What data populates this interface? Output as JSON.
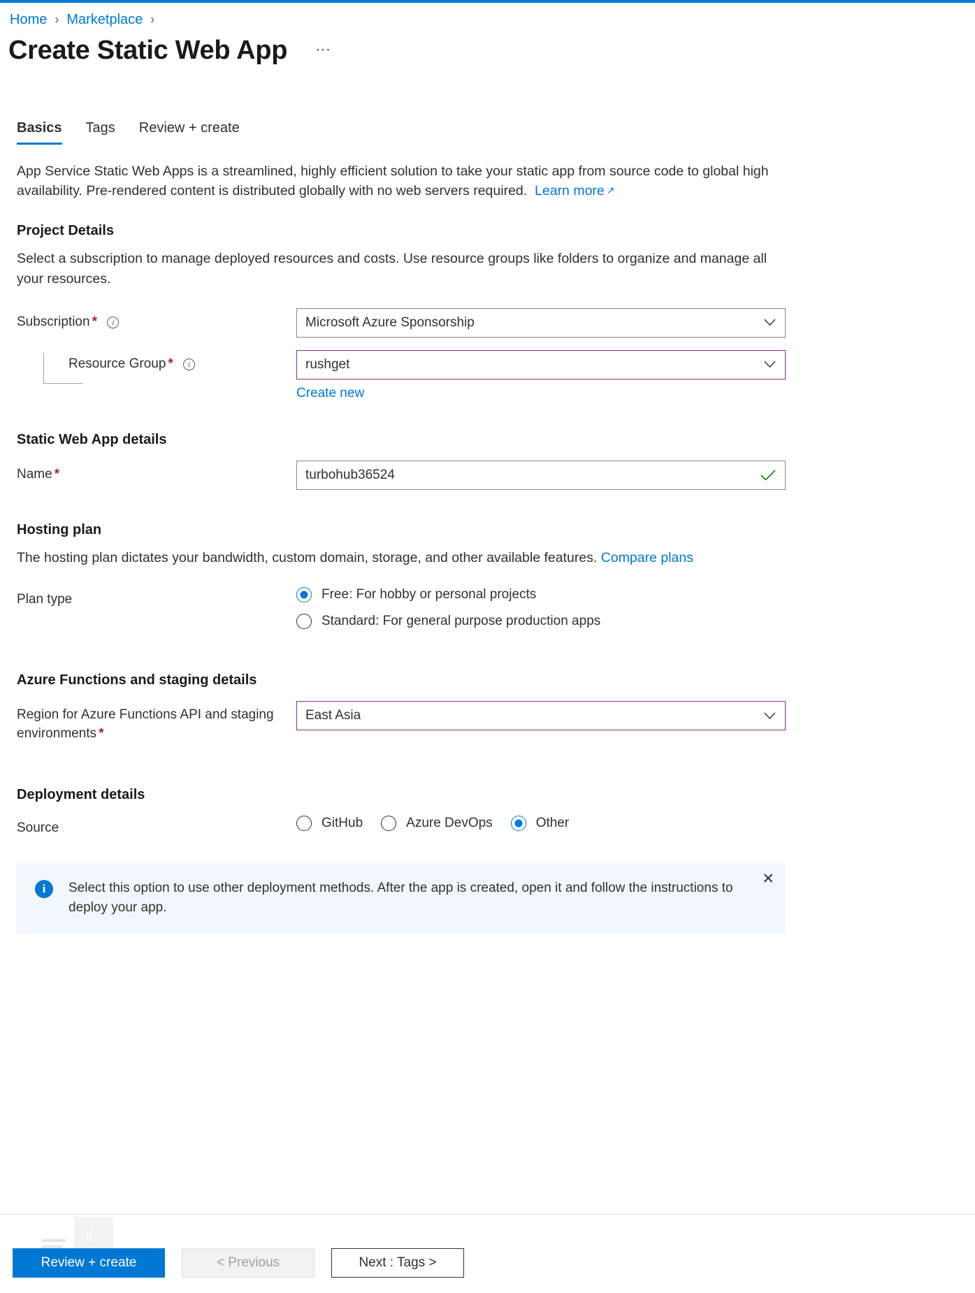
{
  "breadcrumb": {
    "items": [
      {
        "label": "Home"
      },
      {
        "label": "Marketplace"
      }
    ],
    "separator": "›"
  },
  "header": {
    "title": "Create Static Web App",
    "more_actions": "⋯"
  },
  "tabs": [
    {
      "label": "Basics",
      "active": true
    },
    {
      "label": "Tags",
      "active": false
    },
    {
      "label": "Review + create",
      "active": false
    }
  ],
  "intro": {
    "text": "App Service Static Web Apps is a streamlined, highly efficient solution to take your static app from source code to global high availability. Pre-rendered content is distributed globally with no web servers required.",
    "link_label": "Learn more",
    "link_icon": "external-link-icon"
  },
  "project_details": {
    "heading": "Project Details",
    "description": "Select a subscription to manage deployed resources and costs. Use resource groups like folders to organize and manage all your resources.",
    "subscription": {
      "label": "Subscription",
      "required": "*",
      "value": "Microsoft Azure Sponsorship"
    },
    "resource_group": {
      "label": "Resource Group",
      "required": "*",
      "value": "rushget",
      "create_new_label": "Create new",
      "highlight_color": "#8f2d8f"
    }
  },
  "static_web_app_details": {
    "heading": "Static Web App details",
    "name": {
      "label": "Name",
      "required": "*",
      "value": "turbohub36524",
      "validation_icon": "check-icon",
      "validation_color": "#107c10"
    }
  },
  "hosting_plan": {
    "heading": "Hosting plan",
    "description": "The hosting plan dictates your bandwidth, custom domain, storage, and other available features.",
    "compare_link": "Compare plans",
    "plan_type_label": "Plan type",
    "options": [
      {
        "label": "Free: For hobby or personal projects",
        "selected": true
      },
      {
        "label": "Standard: For general purpose production apps",
        "selected": false
      }
    ]
  },
  "azure_functions": {
    "heading": "Azure Functions and staging details",
    "region": {
      "label": "Region for Azure Functions API and staging environments",
      "required": "*",
      "value": "East Asia",
      "highlight_color": "#8f2d8f"
    }
  },
  "deployment_details": {
    "heading": "Deployment details",
    "source_label": "Source",
    "options": [
      {
        "label": "GitHub",
        "selected": false
      },
      {
        "label": "Azure DevOps",
        "selected": false
      },
      {
        "label": "Other",
        "selected": true
      }
    ]
  },
  "info_banner": {
    "icon": "info-icon",
    "text": "Select this option to use other deployment methods. After the app is created, open it and follow the instructions to deploy your app.",
    "close_label": "✕",
    "background": "#f2f7fd"
  },
  "footer": {
    "review_create": "Review + create",
    "previous": "< Previous",
    "next": "Next : Tags >"
  },
  "icons": {
    "chevron_down": "⌄",
    "check": "✓",
    "info": "i",
    "external_link": "↗"
  }
}
